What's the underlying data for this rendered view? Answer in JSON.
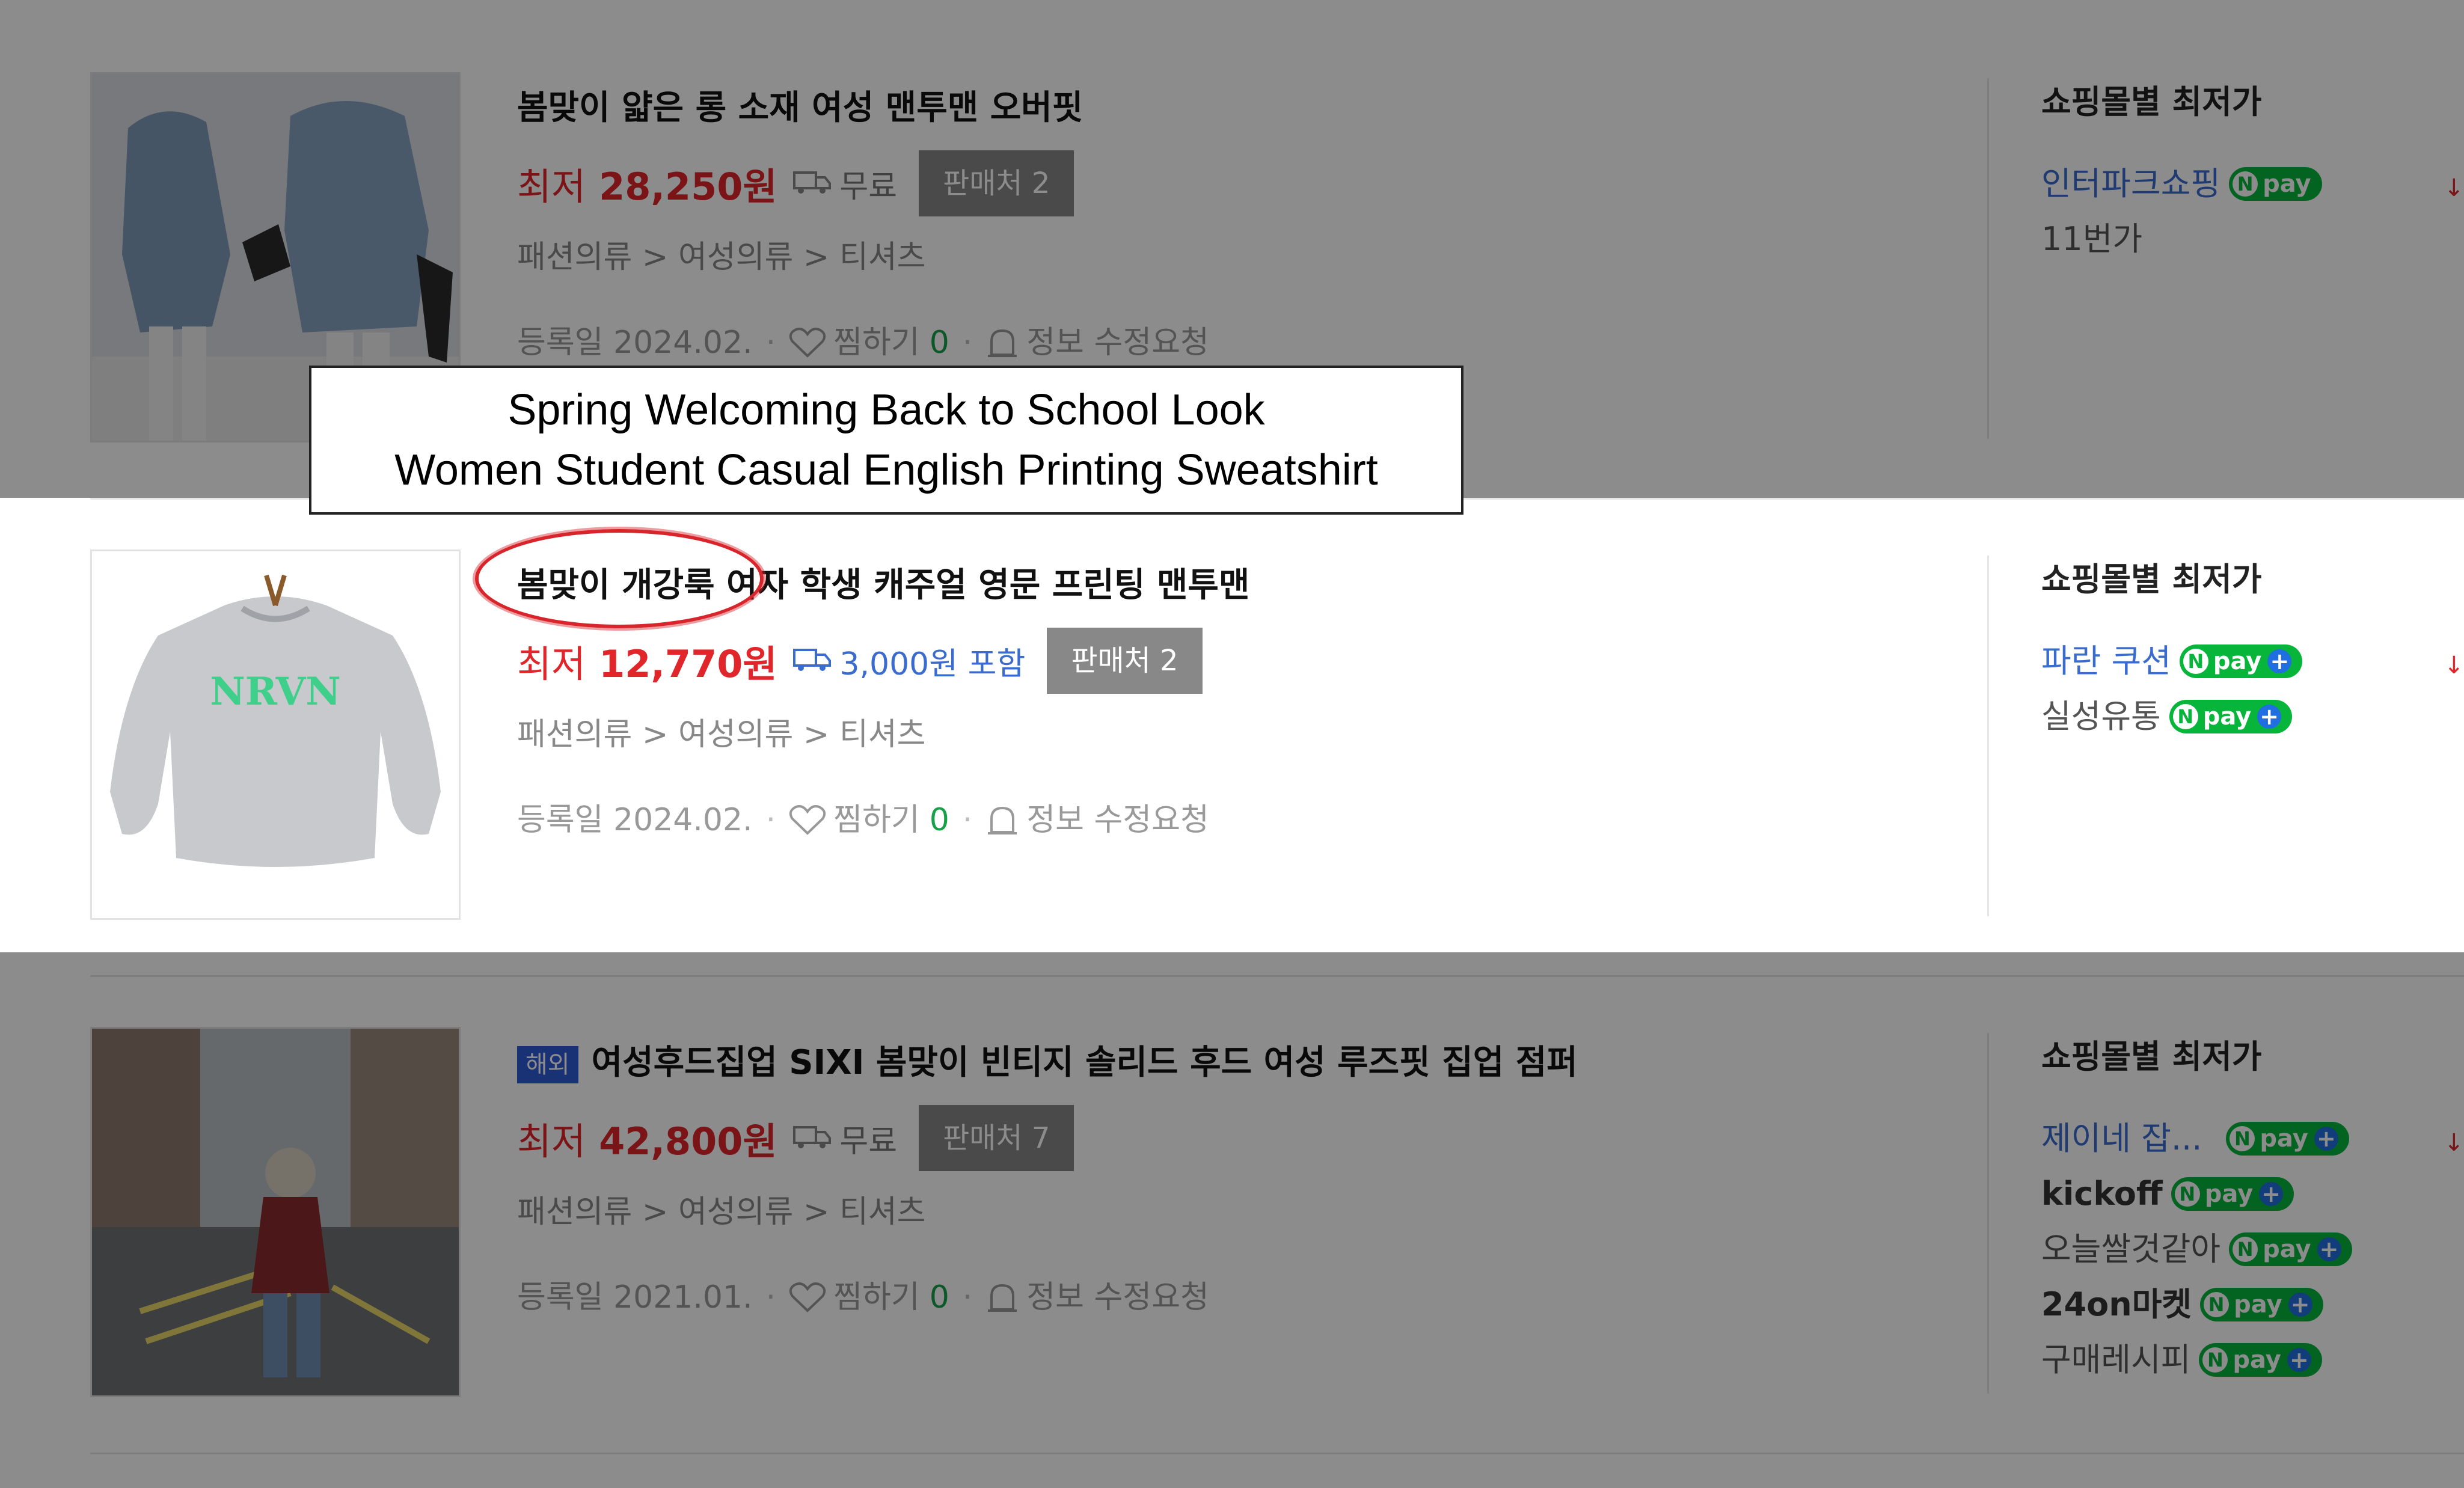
{
  "products": [
    {
      "title": "봄맞이 얇은 롱 소재 여성 맨투맨 오버핏",
      "price_prefix": "최저",
      "price": "28,250원",
      "shipping": "무료",
      "sellers": "판매처 2",
      "category": "패션의류 > 여성의류 > 티셔츠",
      "registered": "등록일 2024.02.",
      "wishlist": "찜하기",
      "wishlist_count": "0",
      "report": "정보 수정요청",
      "mall_header": "쇼핑몰별 최저가",
      "malls": [
        {
          "name": "인터파크쇼핑",
          "npay": "pay"
        },
        {
          "name": "11번가"
        }
      ]
    },
    {
      "title": "봄맞이 개강룩 여자 학생 캐주얼 영문 프린팅 맨투맨",
      "price_prefix": "최저",
      "price": "12,770원",
      "shipping": "3,000원 포함",
      "sellers": "판매처 2",
      "category": "패션의류 > 여성의류 > 티셔츠",
      "registered": "등록일 2024.02.",
      "wishlist": "찜하기",
      "wishlist_count": "0",
      "report": "정보 수정요청",
      "mall_header": "쇼핑몰별 최저가",
      "malls": [
        {
          "name": "파란 쿠션",
          "npay": "pay"
        },
        {
          "name": "실성유통",
          "npay": "pay"
        }
      ]
    },
    {
      "badge": "해외",
      "title": "여성후드집업 SIXI 봄맞이 빈티지 솔리드 후드 여성 루즈핏 집업 점퍼",
      "price_prefix": "최저",
      "price": "42,800원",
      "shipping": "무료",
      "sellers": "판매처 7",
      "category": "패션의류 > 여성의류 > 티셔츠",
      "registered": "등록일 2021.01.",
      "wishlist": "찜하기",
      "wishlist_count": "0",
      "report": "정보 수정요청",
      "mall_header": "쇼핑몰별 최저가",
      "malls": [
        {
          "name": "제이네 잡...",
          "npay": "pay"
        },
        {
          "name": "kickoff",
          "npay": "pay"
        },
        {
          "name": "오늘쌀것같아",
          "npay": "pay"
        },
        {
          "name": "24on마켓",
          "npay": "pay"
        },
        {
          "name": "구매레시피",
          "npay": "pay"
        }
      ]
    }
  ],
  "caption": {
    "line1": "Spring Welcoming Back to School Look",
    "line2": "Women Student Casual English Printing Sweatshirt"
  },
  "sweatshirt_print": "NRVN",
  "colors": {
    "price_red": "#e0262b",
    "npay_green": "#07b53b",
    "link_blue": "#3a6ccf",
    "highlight_circle": "#d8252b"
  }
}
